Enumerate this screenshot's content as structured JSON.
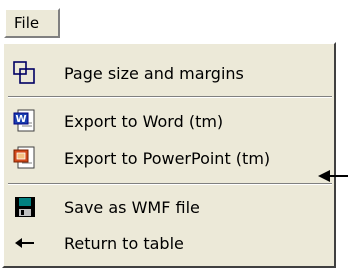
{
  "menu": {
    "title": "File",
    "items": [
      {
        "label": "Page size and margins",
        "icon": "page-size-icon"
      },
      {
        "label": "Export to Word (tm)",
        "icon": "word-icon"
      },
      {
        "label": "Export to PowerPoint (tm)",
        "icon": "powerpoint-icon"
      },
      {
        "label": "Save as WMF file",
        "icon": "save-disk-icon"
      },
      {
        "label": "Return to table",
        "icon": "back-arrow-icon"
      }
    ]
  },
  "colors": {
    "menu_bg": "#ece9d8",
    "word_blue": "#1a3fb0",
    "powerpoint_orange": "#d24a1a",
    "disk_teal": "#008080"
  }
}
